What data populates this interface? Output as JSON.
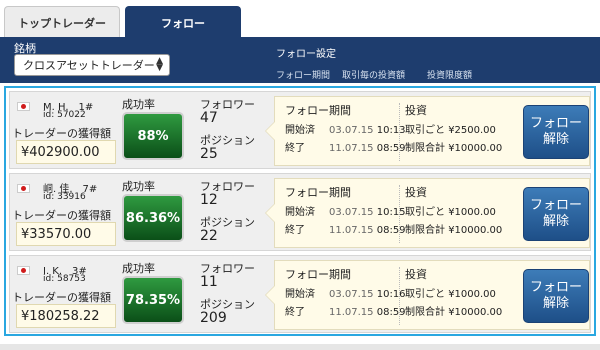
{
  "tabs": {
    "top_traders": "トップトレーダー",
    "follow": "フォロー"
  },
  "header": {
    "brand_label": "銘柄",
    "select_value": "クロスアセットトレーダー",
    "follow_settings": "フォロー設定",
    "sub_period": "フォロー期間",
    "sub_per_trade": "取引毎の投資額",
    "sub_limit": "投資限度額"
  },
  "labels": {
    "earnings": "トレーダーの獲得額",
    "success_rate": "成功率",
    "followers": "フォロワー",
    "positions": "ポジション",
    "follow_period": "フォロー期間",
    "started": "開始済",
    "end": "終了",
    "investment": "投資",
    "per_trade": "取引ごと",
    "limit_total": "制限合計",
    "unfollow": "フォロー解除"
  },
  "traders": [
    {
      "name": "M. H.　1#",
      "id": "id: 57022",
      "earnings": "¥402900.00",
      "success_rate": "88%",
      "followers": "47",
      "positions": "25",
      "start_date": "03.07.15",
      "start_time": "10:13",
      "end_date": "11.07.15",
      "end_time": "08:59",
      "per_trade": "¥2500.00",
      "limit": "¥10000.00"
    },
    {
      "name": "峒. 佳.　7#",
      "id": "id: 33916",
      "earnings": "¥33570.00",
      "success_rate": "86.36%",
      "followers": "12",
      "positions": "22",
      "start_date": "03.07.15",
      "start_time": "10:15",
      "end_date": "11.07.15",
      "end_time": "08:59",
      "per_trade": "¥1000.00",
      "limit": "¥10000.00"
    },
    {
      "name": "I. K.　3#",
      "id": "id: 58753",
      "earnings": "¥180258.22",
      "success_rate": "78.35%",
      "followers": "11",
      "positions": "209",
      "start_date": "03.07.15",
      "start_time": "10:16",
      "end_date": "11.07.15",
      "end_time": "08:59",
      "per_trade": "¥1000.00",
      "limit": "¥10000.00"
    }
  ],
  "colors": {
    "header_bg": "#1e3d6e",
    "accent_border": "#2aa7e0",
    "rate_green": "#1f7a30",
    "button_blue": "#2b64a0"
  }
}
